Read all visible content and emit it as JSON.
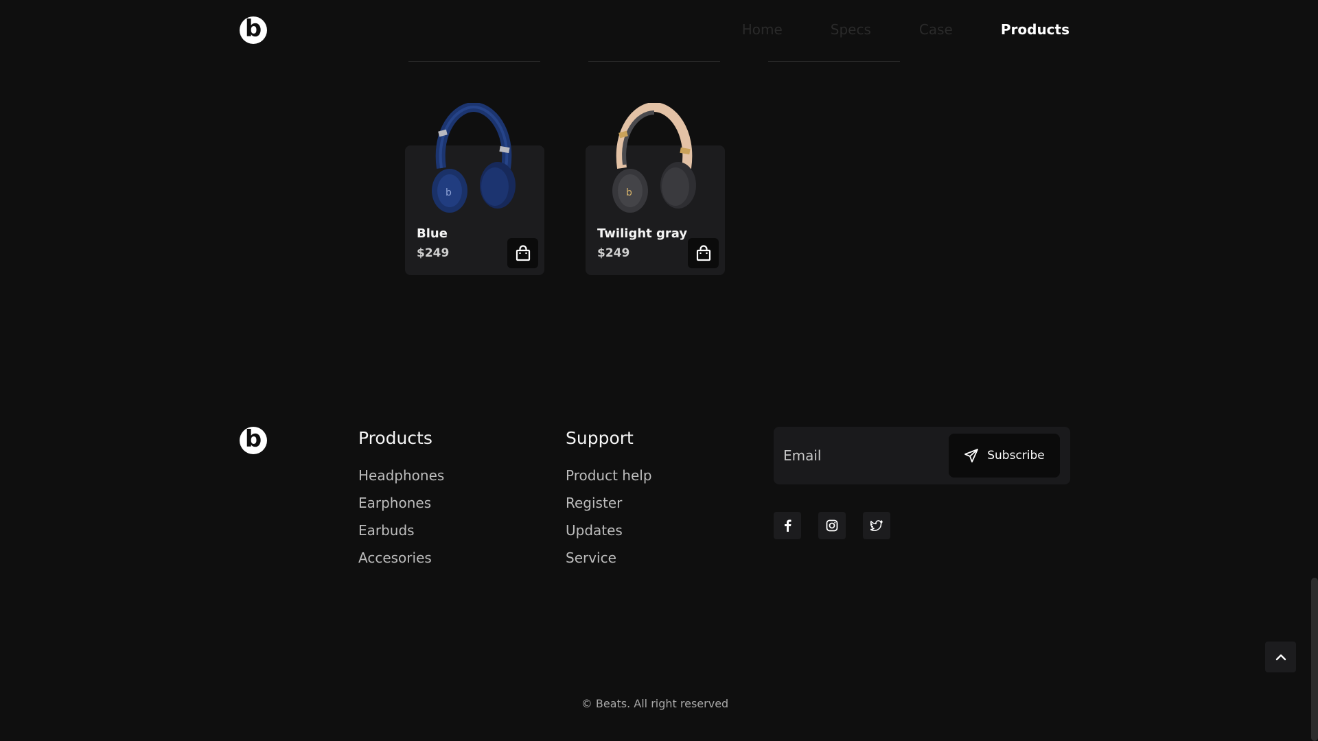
{
  "header": {
    "logo_letter": "b",
    "nav": [
      "Home",
      "Specs",
      "Case",
      "Products"
    ],
    "active_nav": "Products"
  },
  "products": [
    {
      "name": "Blue",
      "price": "$249",
      "color": "#1e3a7a"
    },
    {
      "name": "Twilight gray",
      "price": "$249",
      "color": "#3b3b3f",
      "band_color": "#e8c9b0"
    }
  ],
  "footer": {
    "logo_letter": "b",
    "products_title": "Products",
    "products_links": [
      "Headphones",
      "Earphones",
      "Earbuds",
      "Accesories"
    ],
    "support_title": "Support",
    "support_links": [
      "Product help",
      "Register",
      "Updates",
      "Service"
    ],
    "email_placeholder": "Email",
    "subscribe_label": "Subscribe",
    "socials": [
      "facebook-icon",
      "instagram-icon",
      "twitter-icon"
    ],
    "copyright": "© Beats. All right reserved"
  }
}
